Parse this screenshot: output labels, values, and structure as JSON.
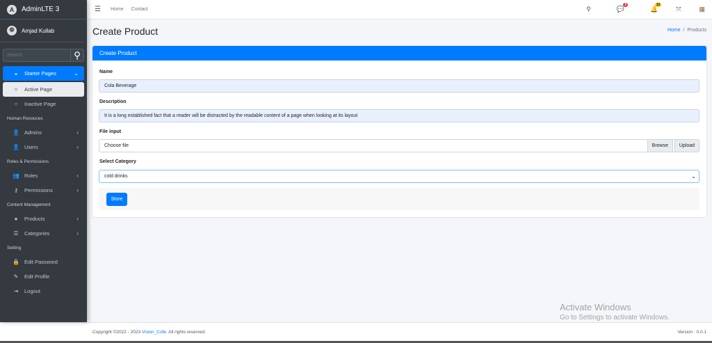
{
  "brand": "AdminLTE 3",
  "user": "Amjad Kullab",
  "search_placeholder": "Search",
  "sidebar": {
    "starter": "Starter Pages",
    "active": "Active Page",
    "inactive": "Inactive Page",
    "h1": "Human Resouces",
    "admins": "Admins",
    "users": "Users",
    "h2": "Roles & Permissions",
    "roles": "Roles",
    "permissions": "Permissions",
    "h3": "Content Management",
    "products": "Products",
    "categories": "Categories",
    "h4": "Setting",
    "edit_password": "Edit Password",
    "edit_profile": "Edit Profile",
    "logout": "Logout"
  },
  "topnav": {
    "home": "Home",
    "contact": "Contact",
    "messages_count": "3",
    "notif_count": "15"
  },
  "page_title": "Create Product",
  "breadcrumb": {
    "home": "Home",
    "current": "Products"
  },
  "card": {
    "title": "Create Product",
    "name_label": "Name",
    "name_value": "Cola Beverage",
    "desc_label": "Description",
    "desc_value": "It is a long established fact that a reader will be distracted by the readable content of a page when looking at its layout",
    "file_label": "File input",
    "file_placeholder": "Choose file",
    "browse": "Browse",
    "upload": "Upload",
    "cat_label": "Select Category",
    "cat_value": "cold drinks",
    "store": "Store"
  },
  "footer": {
    "copyright": "Copyright ©2022 - 2023",
    "company": "Vision_Cofe.",
    "rights": "All rights reserved.",
    "version": "Version : 0.0.1"
  },
  "watermark": {
    "line1": "Activate Windows",
    "line2": "Go to Settings to activate Windows."
  }
}
